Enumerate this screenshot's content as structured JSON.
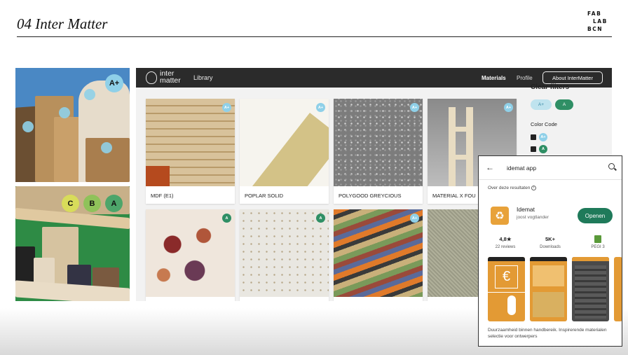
{
  "slide": {
    "title": "04 Inter Matter",
    "logo_lines": [
      "FAB",
      "LAB",
      "BCN"
    ]
  },
  "photos": {
    "grade_top": "A+",
    "grades_bottom": [
      "C",
      "B",
      "A"
    ]
  },
  "app": {
    "brand_top": "inter",
    "brand_bottom": "matter",
    "nav": {
      "library": "Library",
      "materials": "Materials",
      "profile": "Profile",
      "about": "About InterMatter"
    },
    "cards": [
      {
        "label": "MDF (E1)",
        "badge": "A+"
      },
      {
        "label": "POPLAR SOLID",
        "badge": "A+"
      },
      {
        "label": "POLYGOOD GREYCIOUS",
        "badge": "A+"
      },
      {
        "label": "MATERIAL X FOU",
        "badge": "A+"
      },
      {
        "label": "",
        "badge": "A"
      },
      {
        "label": "",
        "badge": "A"
      },
      {
        "label": "",
        "badge": "A+"
      },
      {
        "label": "",
        "badge": ""
      }
    ],
    "filters": {
      "title": "Clear filters",
      "pill_1": "A+",
      "pill_2": "A",
      "color_code": "Color Code",
      "cb_1": "A+",
      "cb_2": "A"
    }
  },
  "phone": {
    "query": "idemat app",
    "about": "Over deze resultaten",
    "app_name": "Idemat",
    "developer": "joost vogtlander",
    "open_label": "Openen",
    "stats": [
      {
        "value": "4,8★",
        "label": "22 reviews"
      },
      {
        "value": "5K+",
        "label": "Downloads"
      },
      {
        "value": "",
        "label": "PEGI 3"
      }
    ],
    "shot_text": "€",
    "description": "Duurzaamheid binnen handbereik. Inspirerende materialen selectie voor ontwerpers"
  },
  "colors": {
    "grade_a_plus": "#8fd0e8",
    "grade_a": "#2f8f65",
    "header": "#2b2b2b",
    "open_button": "#1f7a5a",
    "app_icon": "#e8a23a"
  }
}
